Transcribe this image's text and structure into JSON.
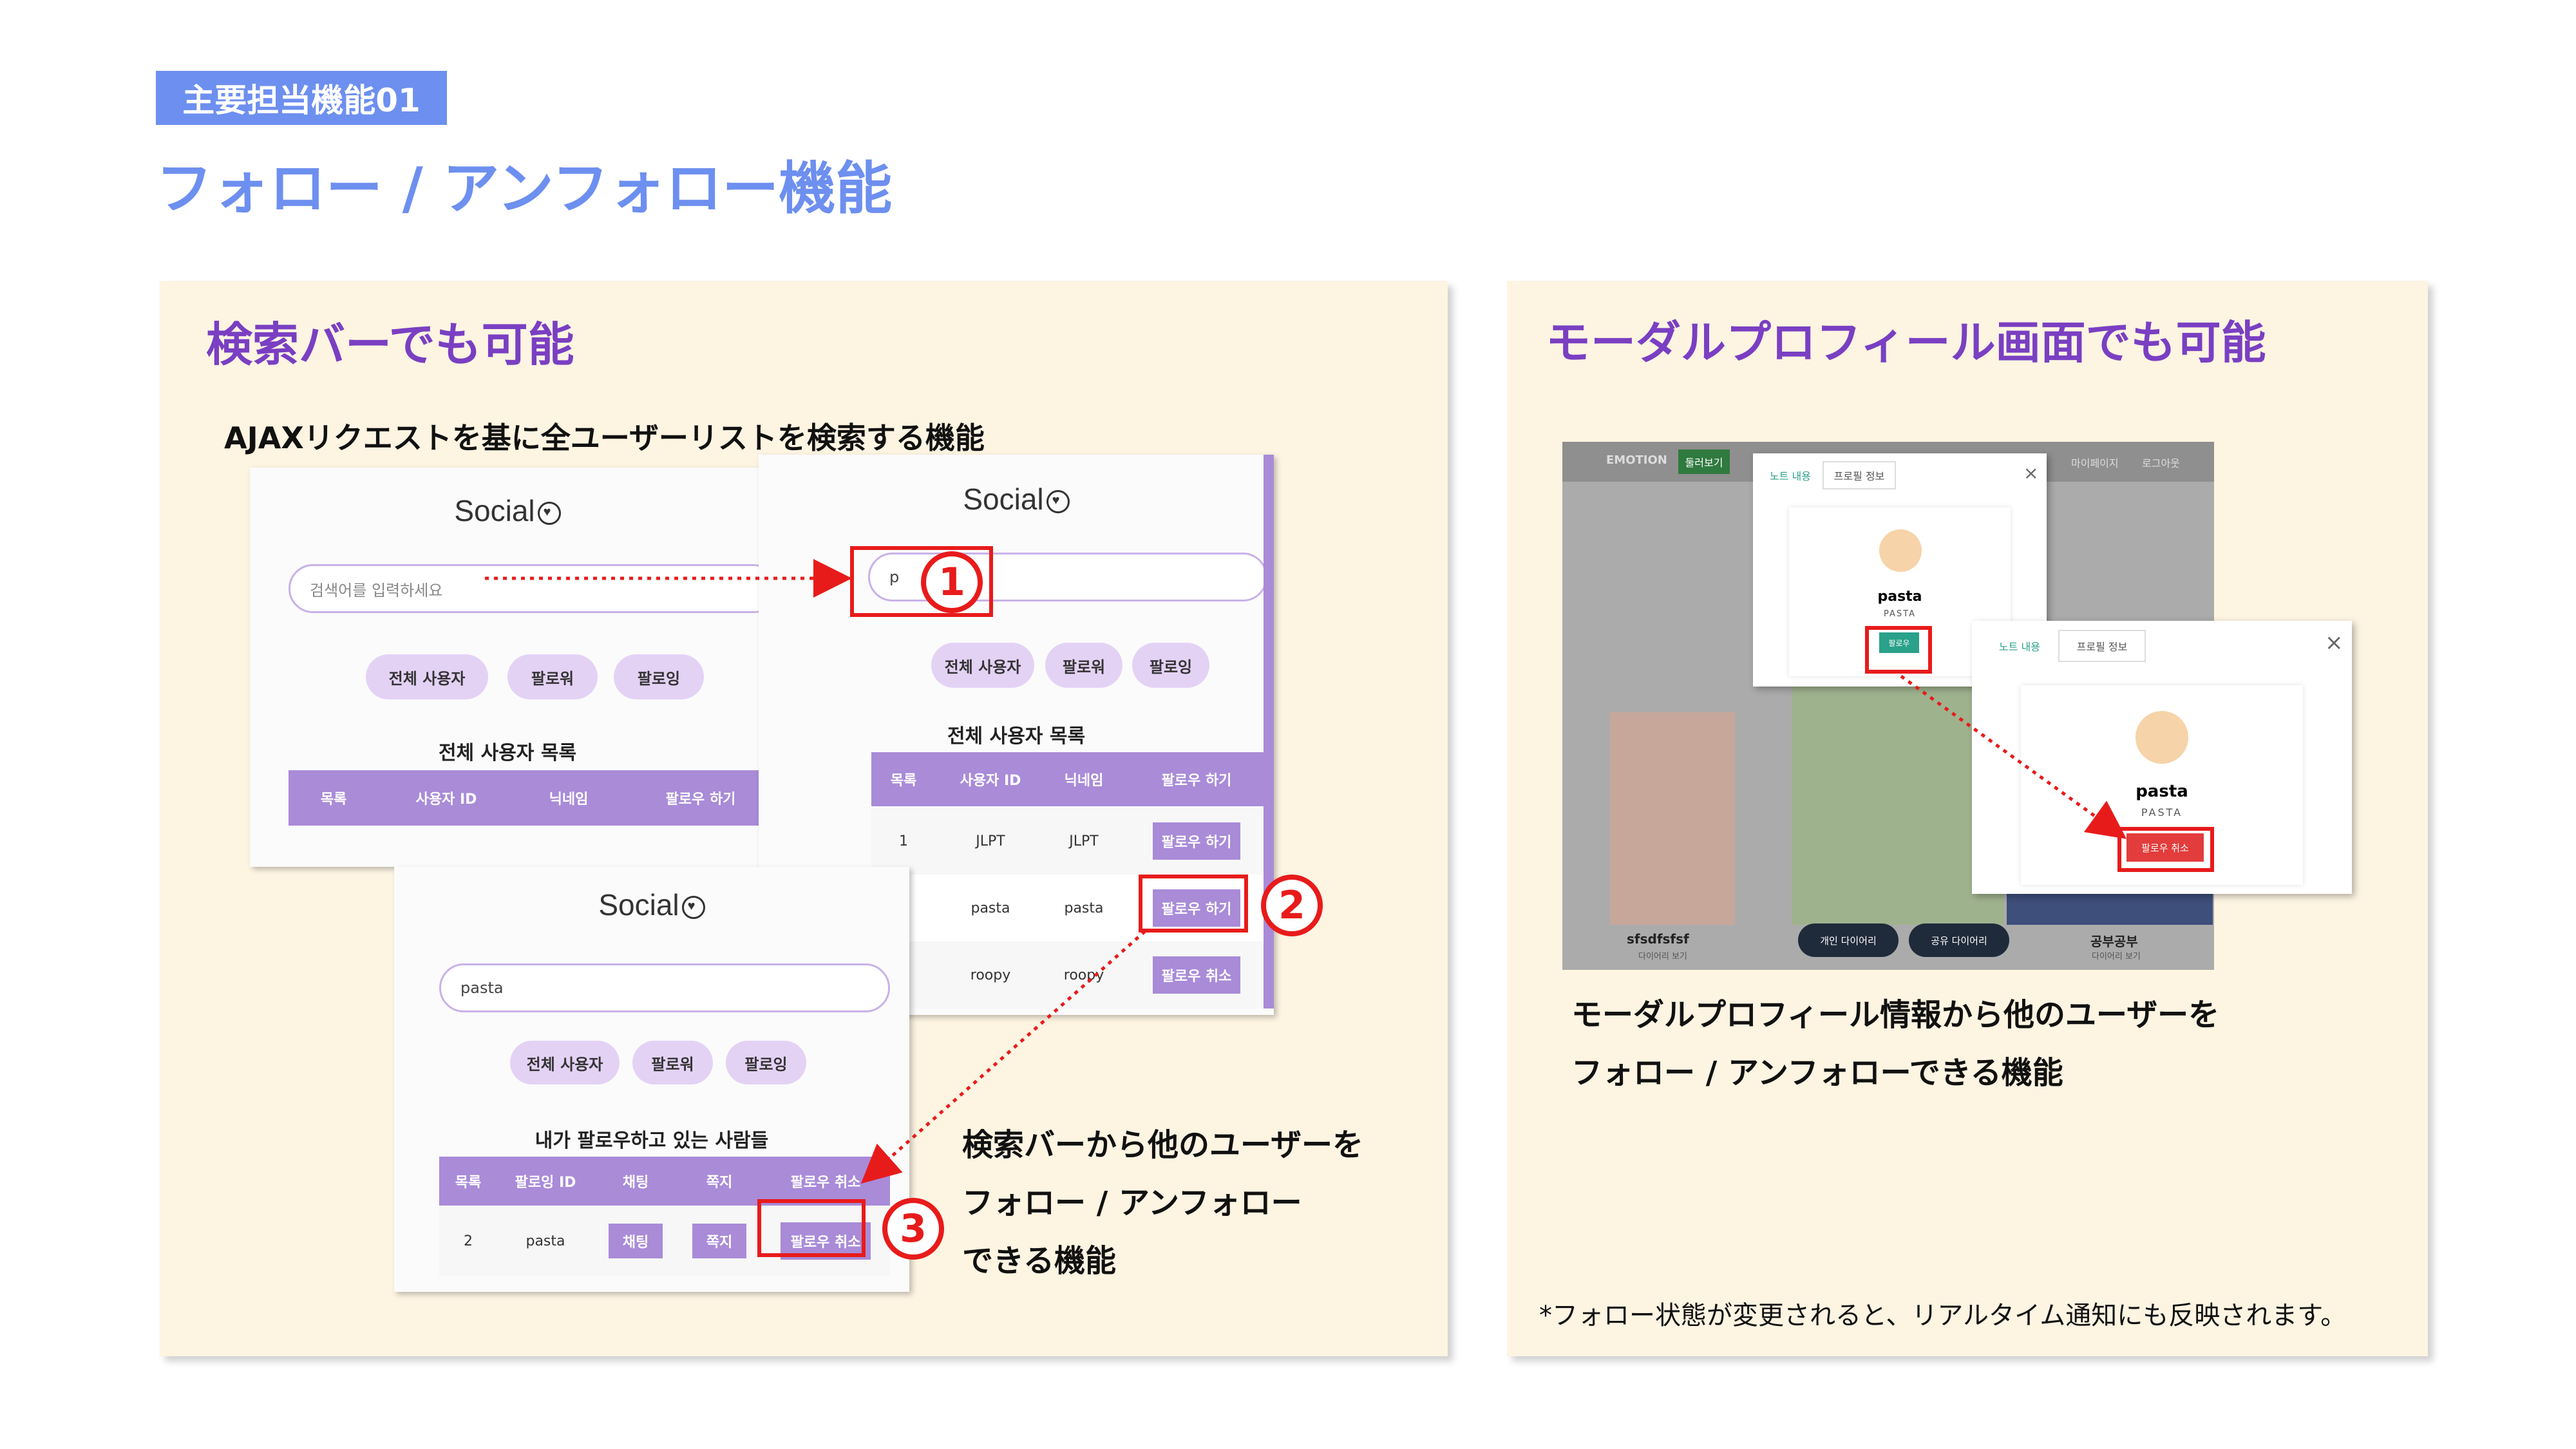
{
  "header": {
    "tag": "主要担当機能01",
    "title": "フォロー / アンフォロー機能"
  },
  "left_panel": {
    "title": "検索バーでも可能",
    "subtitle": "AJAXリクエストを基に全ユーザーリストを検索する機能",
    "caption_lines": [
      "検索バーから他のユーザーを",
      "フォロー / アンフォロー",
      "できる機能"
    ],
    "card_a": {
      "logo": "Social",
      "placeholder": "검색어를 입력하세요",
      "pills": [
        "전체 사용자",
        "팔로워",
        "팔로잉"
      ],
      "table_title": "전체 사용자 목록",
      "headers": [
        "목록",
        "사용자 ID",
        "닉네임",
        "팔로우 하기"
      ]
    },
    "card_b": {
      "logo": "Social",
      "search_value": "p",
      "pills": [
        "전체 사용자",
        "팔로워",
        "팔로잉"
      ],
      "table_title": "전체 사용자 목록",
      "headers": [
        "목록",
        "사용자 ID",
        "닉네임",
        "팔로우 하기"
      ],
      "rows": [
        {
          "no": "1",
          "id": "JLPT",
          "nick": "JLPT",
          "action": "팔로우 하기"
        },
        {
          "no": "",
          "id": "pasta",
          "nick": "pasta",
          "action": "팔로우 하기"
        },
        {
          "no": "",
          "id": "roopy",
          "nick": "roopy",
          "action": "팔로우 취소"
        }
      ]
    },
    "card_c": {
      "logo": "Social",
      "search_value": "pasta",
      "pills": [
        "전체 사용자",
        "팔로워",
        "팔로잉"
      ],
      "table_title": "내가 팔로우하고 있는 사람들",
      "headers": [
        "목록",
        "팔로잉 ID",
        "채팅",
        "쪽지",
        "팔로우 취소"
      ],
      "rows": [
        {
          "no": "2",
          "id": "pasta",
          "chat": "채팅",
          "msg": "쪽지",
          "action": "팔로우 취소"
        }
      ]
    },
    "markers": [
      "1",
      "2",
      "3"
    ]
  },
  "right_panel": {
    "title": "モーダルプロフィール画面でも可能",
    "caption_lines": [
      "モーダルプロフィール情報から他のユーザーを",
      "フォロー / アンフォローできる機能"
    ],
    "note": "*フォロー状態が変更されると、リアルタイム通知にも反映されます。",
    "app": {
      "brand": "EMOTION",
      "nav_active": "둘러보기",
      "nav_right": [
        "마이페이지",
        "로그아웃"
      ],
      "tiles": [
        {
          "title": "sfsdfsfsf",
          "sub": "다이어리 보기"
        },
        {
          "title": "공부공부",
          "sub": "다이어리 보기"
        }
      ],
      "dark_buttons": [
        "개인 다이어리",
        "공유 다이어리"
      ]
    },
    "modal_a": {
      "tabs": [
        "노트 내용",
        "프로필 정보"
      ],
      "name": "pasta",
      "handle": "PASTA",
      "button": "팔로우"
    },
    "modal_b": {
      "tabs": [
        "노트 내용",
        "프로필 정보"
      ],
      "name": "pasta",
      "handle": "PASTA",
      "button": "팔로우 취소"
    }
  }
}
